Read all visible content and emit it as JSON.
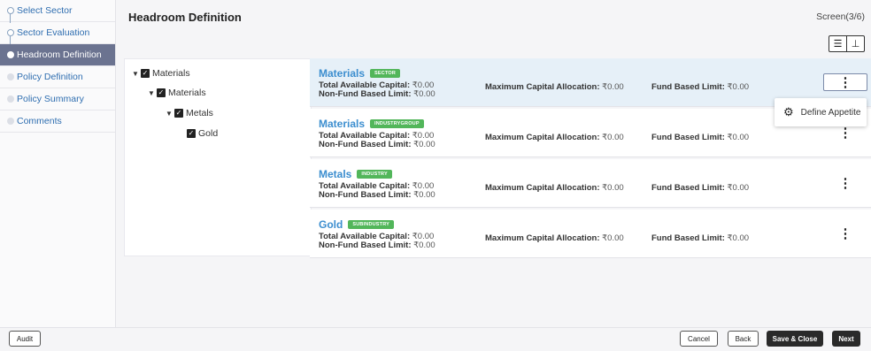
{
  "steps": [
    {
      "label": "Select Sector",
      "state": "done"
    },
    {
      "label": "Sector Evaluation",
      "state": "done"
    },
    {
      "label": "Headroom Definition",
      "state": "current"
    },
    {
      "label": "Policy Definition",
      "state": "todo"
    },
    {
      "label": "Policy Summary",
      "state": "todo"
    },
    {
      "label": "Comments",
      "state": "todo"
    }
  ],
  "header": {
    "title": "Headroom Definition",
    "screen": "Screen(3/6)"
  },
  "tree": [
    {
      "label": "Materials",
      "checked": true,
      "expanded": true
    },
    {
      "label": "Materials",
      "checked": true,
      "expanded": true
    },
    {
      "label": "Metals",
      "checked": true,
      "expanded": true
    },
    {
      "label": "Gold",
      "checked": true,
      "expanded": false
    }
  ],
  "cards": [
    {
      "name": "Materials",
      "type": "SECTOR",
      "tac_label": "Total Available Capital:",
      "tac": "₹0.00",
      "nfb_label": "Non-Fund Based Limit:",
      "nfb": "₹0.00",
      "mca_label": "Maximum Capital Allocation:",
      "mca": "₹0.00",
      "fbl_label": "Fund Based Limit:",
      "fbl": "₹0.00",
      "menu_open": true
    },
    {
      "name": "Materials",
      "type": "INDUSTRYGROUP",
      "tac_label": "Total Available Capital:",
      "tac": "₹0.00",
      "nfb_label": "Non-Fund Based Limit:",
      "nfb": "₹0.00",
      "mca_label": "Maximum Capital Allocation:",
      "mca": "₹0.00",
      "fbl_label": "Fund Based Limit:",
      "fbl": "₹0.00",
      "menu_open": false
    },
    {
      "name": "Metals",
      "type": "INDUSTRY",
      "tac_label": "Total Available Capital:",
      "tac": "₹0.00",
      "nfb_label": "Non-Fund Based Limit:",
      "nfb": "₹0.00",
      "mca_label": "Maximum Capital Allocation:",
      "mca": "₹0.00",
      "fbl_label": "Fund Based Limit:",
      "fbl": "₹0.00",
      "menu_open": false
    },
    {
      "name": "Gold",
      "type": "SUBINDUSTRY",
      "tac_label": "Total Available Capital:",
      "tac": "₹0.00",
      "nfb_label": "Non-Fund Based Limit:",
      "nfb": "₹0.00",
      "mca_label": "Maximum Capital Allocation:",
      "mca": "₹0.00",
      "fbl_label": "Fund Based Limit:",
      "fbl": "₹0.00",
      "menu_open": false
    }
  ],
  "menu": {
    "item": "Define Appetite",
    "icon": "gear-icon"
  },
  "footer": {
    "audit": "Audit",
    "cancel": "Cancel",
    "back": "Back",
    "save_close": "Save & Close",
    "next": "Next"
  },
  "colors": {
    "accent_blue": "#3c8ecf",
    "badge_green": "#52b65a",
    "active_step": "#6b7390",
    "selected_row": "#e6f0f8",
    "primary_button": "#2a2a2a"
  }
}
